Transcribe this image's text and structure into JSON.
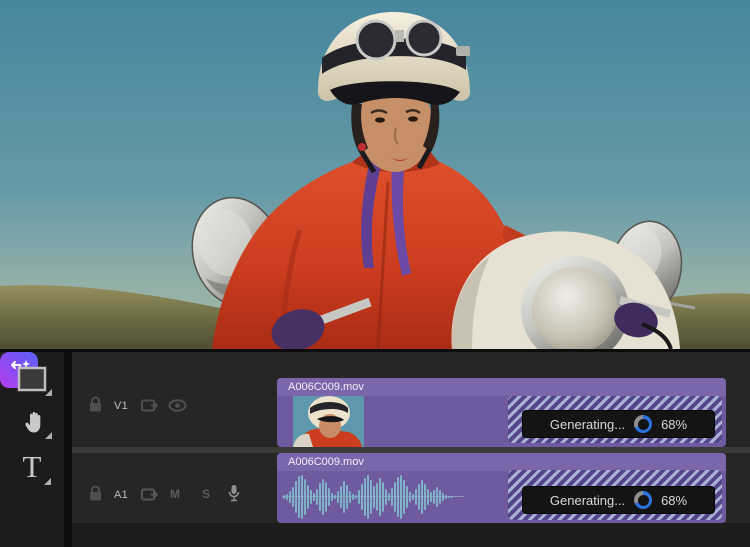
{
  "app": {
    "name": "video-editor-timeline"
  },
  "preview": {
    "description": "Woman in cream helmet with goggles and red leather jacket riding a vintage chrome scooter, blue sky over grassy hills"
  },
  "toolbar": {
    "type_glyph": "T",
    "tools": [
      {
        "name": "frame-tool",
        "icon": "rectangle-icon",
        "has_flyout": true,
        "selected": false
      },
      {
        "name": "hand-tool",
        "icon": "hand-icon",
        "has_flyout": true,
        "selected": false
      },
      {
        "name": "type-tool",
        "icon": "type-icon",
        "has_flyout": true,
        "selected": false
      },
      {
        "name": "generative-extend-tool",
        "icon": "generative-extend-icon",
        "has_flyout": false,
        "selected": true
      }
    ]
  },
  "timeline": {
    "video_track": {
      "label": "V1",
      "icons": [
        "lock-icon",
        "sync-lock-icon",
        "eye-icon"
      ],
      "clip": {
        "name": "A006C009.mov",
        "status_label": "Generating...",
        "progress_label": "68%",
        "progress_value": 68
      }
    },
    "audio_track": {
      "label": "A1",
      "mute_label": "M",
      "solo_label": "S",
      "icons": [
        "lock-icon",
        "sync-lock-icon",
        "microphone-icon"
      ],
      "clip": {
        "name": "A006C009.mov",
        "status_label": "Generating...",
        "progress_label": "68%",
        "progress_value": 68
      },
      "waveform": [
        2,
        3,
        6,
        10,
        16,
        21,
        22,
        18,
        12,
        7,
        4,
        8,
        14,
        18,
        15,
        9,
        4,
        2,
        6,
        11,
        16,
        12,
        6,
        3,
        2,
        7,
        13,
        19,
        22,
        17,
        11,
        14,
        19,
        15,
        8,
        4,
        9,
        15,
        20,
        22,
        17,
        11,
        5,
        3,
        8,
        13,
        17,
        13,
        8,
        5,
        7,
        10,
        7,
        4,
        2,
        1,
        1
      ]
    }
  },
  "colors": {
    "clip_purple": "#6f5aa0",
    "clip_header_purple": "#7b66ac",
    "stripe_light": "#a9b2d4",
    "stripe_dark": "#53458a",
    "progress_blue": "#2a72dd",
    "progress_rest": "#8f8f8f",
    "waveform_blue": "#7fb2c6",
    "tool_gradient_start": "#b23fee",
    "tool_gradient_end": "#5f63f6"
  }
}
